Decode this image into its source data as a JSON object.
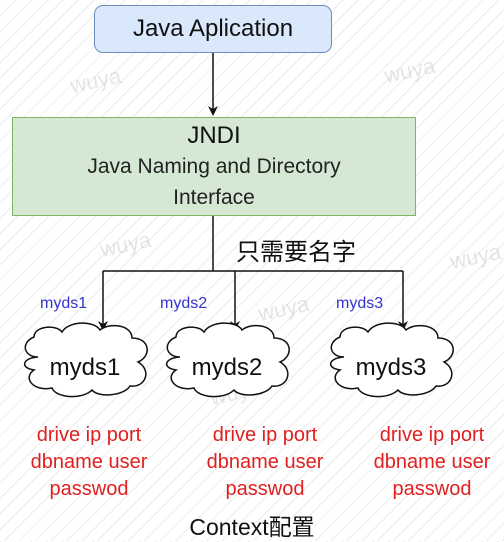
{
  "app": {
    "label": "Java Aplication"
  },
  "jndi": {
    "title": "JNDI",
    "subtitle_line1": "Java Naming and Directory",
    "subtitle_line2": "Interface"
  },
  "note": "只需要名字",
  "datasources": [
    {
      "branch_label": "myds1",
      "cloud_label": "myds1",
      "details": [
        "drive ip port",
        "dbname user",
        "passwod"
      ]
    },
    {
      "branch_label": "myds2",
      "cloud_label": "myds2",
      "details": [
        "drive ip port",
        "dbname user",
        "passwod"
      ]
    },
    {
      "branch_label": "myds3",
      "cloud_label": "myds3",
      "details": [
        "drive ip port",
        "dbname user",
        "passwod"
      ]
    }
  ],
  "footer": "Context配置",
  "watermark": "wuya",
  "colors": {
    "app_fill": "#dae8fc",
    "jndi_fill": "#d5e8d4",
    "detail_text": "#e02020",
    "branch_label_text": "#3333cc"
  }
}
